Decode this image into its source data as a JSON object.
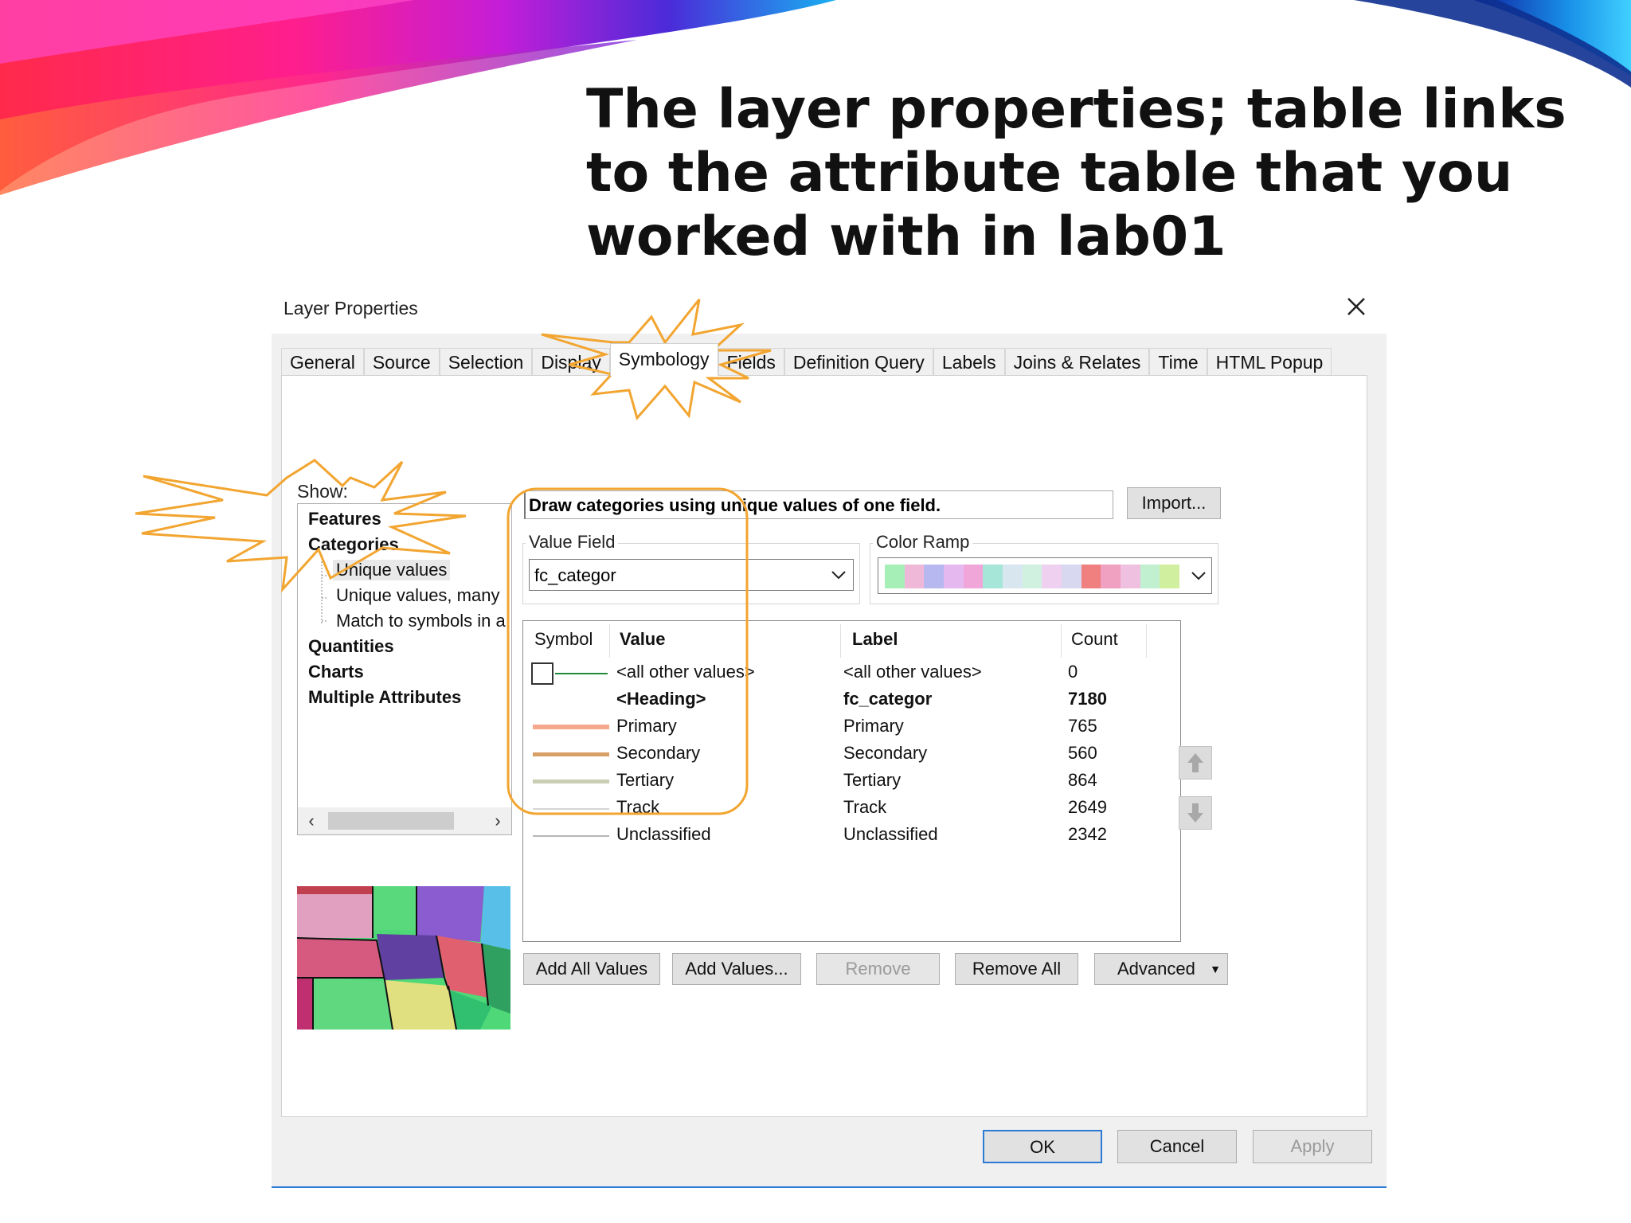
{
  "slide": {
    "title": "The layer properties; table links to the attribute table that you worked with in lab01"
  },
  "dialog": {
    "title": "Layer Properties",
    "close_icon": "close-icon",
    "tabs": [
      {
        "label": "General"
      },
      {
        "label": "Source"
      },
      {
        "label": "Selection"
      },
      {
        "label": "Display"
      },
      {
        "label": "Symbology",
        "active": true
      },
      {
        "label": "Fields"
      },
      {
        "label": "Definition Query"
      },
      {
        "label": "Labels"
      },
      {
        "label": "Joins & Relates"
      },
      {
        "label": "Time"
      },
      {
        "label": "HTML Popup"
      }
    ],
    "show_label": "Show:",
    "tree": {
      "features": "Features",
      "categories": "Categories",
      "unique_values": "Unique values",
      "unique_values_many": "Unique values, many",
      "match_to_symbols": "Match to symbols in a",
      "quantities": "Quantities",
      "charts": "Charts",
      "multiple_attributes": "Multiple Attributes",
      "scroll_left_icon": "chevron-left-icon",
      "scroll_right_icon": "chevron-right-icon"
    },
    "description": "Draw categories using unique values of one field.",
    "import_button": "Import...",
    "value_field": {
      "label": "Value Field",
      "value": "fc_categor",
      "dropdown_icon": "chevron-down-icon"
    },
    "color_ramp": {
      "label": "Color Ramp",
      "colors": [
        "#a6f0b8",
        "#f0b8d8",
        "#b8b8f0",
        "#e6b8f0",
        "#f0a6d8",
        "#a6e6d8",
        "#d8e6f0",
        "#d0f0e0",
        "#f0d0f0",
        "#d8d8f0",
        "#f08080",
        "#f0a0c0",
        "#f0c0e0",
        "#c0f0d0",
        "#d0f0a0"
      ],
      "dropdown_icon": "chevron-down-icon"
    },
    "table": {
      "headers": {
        "symbol": "Symbol",
        "value": "Value",
        "label": "Label",
        "count": "Count"
      },
      "rows": [
        {
          "value": "<all other values>",
          "label": "<all other values>",
          "count": "0",
          "bold": false,
          "color": "#1f8a3a"
        },
        {
          "value": "<Heading>",
          "label": "fc_categor",
          "count": "7180",
          "bold": true,
          "color": ""
        },
        {
          "value": "Primary",
          "label": "Primary",
          "count": "765",
          "bold": false,
          "color": "#f5a88c"
        },
        {
          "value": "Secondary",
          "label": "Secondary",
          "count": "560",
          "bold": false,
          "color": "#d9a066"
        },
        {
          "value": "Tertiary",
          "label": "Tertiary",
          "count": "864",
          "bold": false,
          "color": "#c9cdb2"
        },
        {
          "value": "Track",
          "label": "Track",
          "count": "2649",
          "bold": false,
          "color": "#d6d6d6"
        },
        {
          "value": "Unclassified",
          "label": "Unclassified",
          "count": "2342",
          "bold": false,
          "color": "#b5b5b5"
        }
      ]
    },
    "move_up_icon": "arrow-up-icon",
    "move_down_icon": "arrow-down-icon",
    "buttons": {
      "add_all_values": "Add All Values",
      "add_values": "Add Values...",
      "remove": "Remove",
      "remove_all": "Remove All",
      "advanced": "Advanced",
      "advanced_icon": "caret-down-icon"
    },
    "footer": {
      "ok": "OK",
      "cancel": "Cancel",
      "apply": "Apply"
    }
  },
  "colors": {
    "accent_blue": "#2a7ad6",
    "highlight_orange": "#f2a530"
  }
}
